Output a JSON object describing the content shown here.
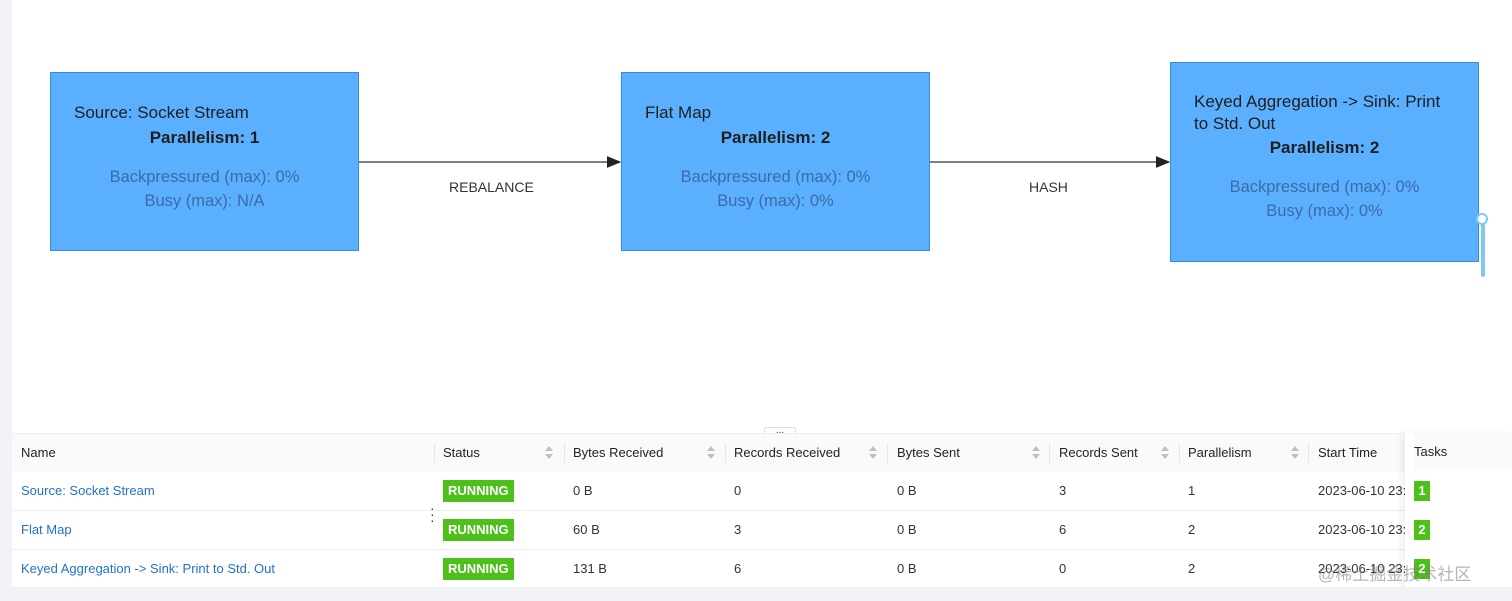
{
  "graph": {
    "nodes": [
      {
        "title": "Source: Socket Stream",
        "parallelism": "Parallelism: 1",
        "backpressured": "Backpressured (max): 0%",
        "busy": "Busy (max): N/A"
      },
      {
        "title": "Flat Map",
        "parallelism": "Parallelism: 2",
        "backpressured": "Backpressured (max): 0%",
        "busy": "Busy (max): 0%"
      },
      {
        "title": "Keyed Aggregation -> Sink: Print to Std. Out",
        "parallelism": "Parallelism: 2",
        "backpressured": "Backpressured (max): 0%",
        "busy": "Busy (max): 0%"
      }
    ],
    "edges": [
      "REBALANCE",
      "HASH"
    ],
    "node_color": "#5ab0ff"
  },
  "splitter_label": "...",
  "table": {
    "headers": {
      "name": "Name",
      "status": "Status",
      "bytes_received": "Bytes Received",
      "records_received": "Records Received",
      "bytes_sent": "Bytes Sent",
      "records_sent": "Records Sent",
      "parallelism": "Parallelism",
      "start_time": "Start Time",
      "tasks": "Tasks"
    },
    "rows": [
      {
        "name": "Source: Socket Stream",
        "status": "RUNNING",
        "bytes_received": "0 B",
        "records_received": "0",
        "bytes_sent": "0 B",
        "records_sent": "3",
        "parallelism": "1",
        "start_time": "2023-06-10 23:",
        "tasks": "1"
      },
      {
        "name": "Flat Map",
        "status": "RUNNING",
        "bytes_received": "60 B",
        "records_received": "3",
        "bytes_sent": "0 B",
        "records_sent": "6",
        "parallelism": "2",
        "start_time": "2023-06-10 23:",
        "tasks": "2"
      },
      {
        "name": "Keyed Aggregation -> Sink: Print to Std. Out",
        "status": "RUNNING",
        "bytes_received": "131 B",
        "records_received": "6",
        "bytes_sent": "0 B",
        "records_sent": "0",
        "parallelism": "2",
        "start_time": "2023-06-10 23:",
        "tasks": "2"
      }
    ],
    "status_color": "#4dc01a"
  },
  "watermark": "@稀土掘金技术社区"
}
